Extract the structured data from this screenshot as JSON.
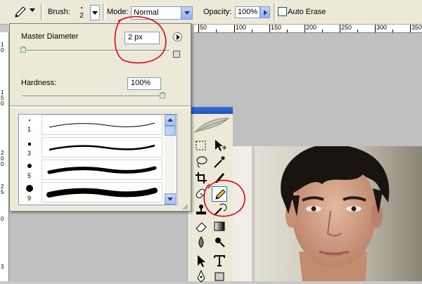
{
  "options_bar": {
    "brush_label": "Brush:",
    "brush_size_value": "2",
    "mode_label": "Mode:",
    "mode_value": "Normal",
    "opacity_label": "Opacity:",
    "opacity_value": "100%",
    "auto_erase_label": "Auto Erase",
    "auto_erase_checked": false,
    "active_tool_icon": "pencil-icon"
  },
  "ruler": {
    "top_ticks": [
      "50",
      "100",
      "150",
      "200",
      "250",
      "300",
      "350"
    ],
    "left_ticks": [
      "1",
      "0",
      "1",
      "5",
      "0",
      "2",
      "0",
      "0",
      "2",
      "5",
      "0",
      "3"
    ]
  },
  "brush_popup": {
    "master_diameter_label": "Master Diameter",
    "master_diameter_value": "2 px",
    "master_diameter_level": 0.01,
    "hardness_label": "Hardness:",
    "hardness_value": "100%",
    "hardness_level": 1.0,
    "brushes": [
      {
        "size_label": "1"
      },
      {
        "size_label": "3"
      },
      {
        "size_label": "5"
      },
      {
        "size_label": "9"
      }
    ]
  },
  "tools_panel": {
    "tools": [
      "marquee-icon",
      "move-icon",
      "lasso-icon",
      "magic-wand-icon",
      "crop-icon",
      "slice-icon",
      "healing-brush-icon",
      "pencil-icon",
      "clone-stamp-icon",
      "history-brush-icon",
      "eraser-icon",
      "gradient-icon",
      "blur-icon",
      "dodge-icon",
      "path-selection-icon",
      "type-icon",
      "pen-icon",
      "shape-icon"
    ],
    "selected_tool": "pencil-icon"
  },
  "colors": {
    "annotation": "#e0001a",
    "panel_bg": "#ece9d8",
    "xp_blue": "#316ac5"
  }
}
